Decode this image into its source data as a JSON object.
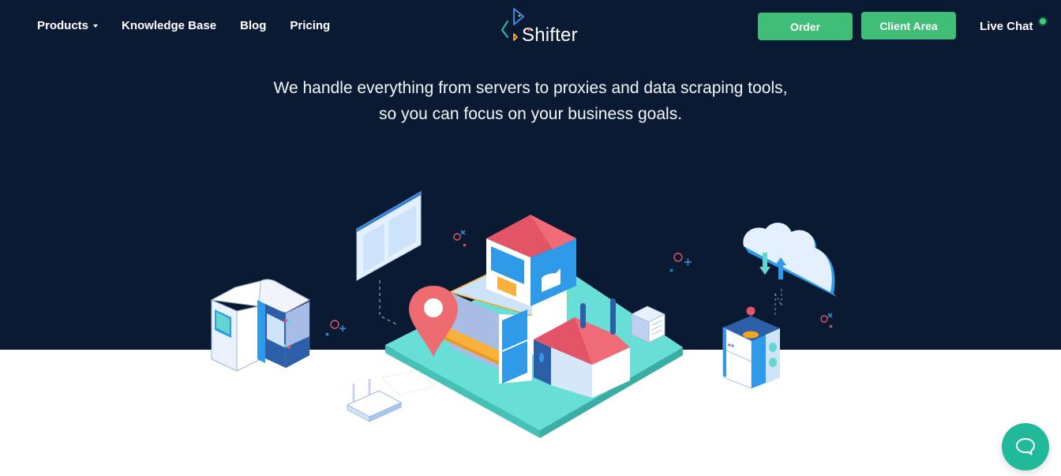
{
  "nav": {
    "items": [
      {
        "label": "Products",
        "has_dropdown": true
      },
      {
        "label": "Knowledge Base"
      },
      {
        "label": "Blog"
      },
      {
        "label": "Pricing"
      }
    ],
    "logo_text": "Shifter",
    "order_label": "Order",
    "client_area_label": "Client Area",
    "live_chat_label": "Live Chat",
    "live_chat_status": "online"
  },
  "hero": {
    "line1": "We handle everything from servers to proxies and data scraping tools,",
    "line2": "so you can focus on your business goals."
  },
  "illustration": {
    "description": "Isometric scene: houses on a teal platform, location pin, server cabinet, browser window, router, cloud with sync arrows, device box, storage unit",
    "icons": [
      "server-cabinet-icon",
      "browser-window-icon",
      "location-pin-icon",
      "house-icon",
      "router-icon",
      "cloud-sync-icon",
      "device-box-icon",
      "storage-unit-icon"
    ]
  },
  "chat_widget": {
    "icon": "chat-bubble-icon"
  },
  "colors": {
    "hero_bg": "#0b1a33",
    "accent_green": "#40bd77",
    "chat_teal": "#20b99a",
    "platform_teal": "#67dfd6",
    "roof_red": "#e35566",
    "pin_red": "#ee6b72",
    "orange": "#fbb03b",
    "blue": "#2f9be8"
  }
}
